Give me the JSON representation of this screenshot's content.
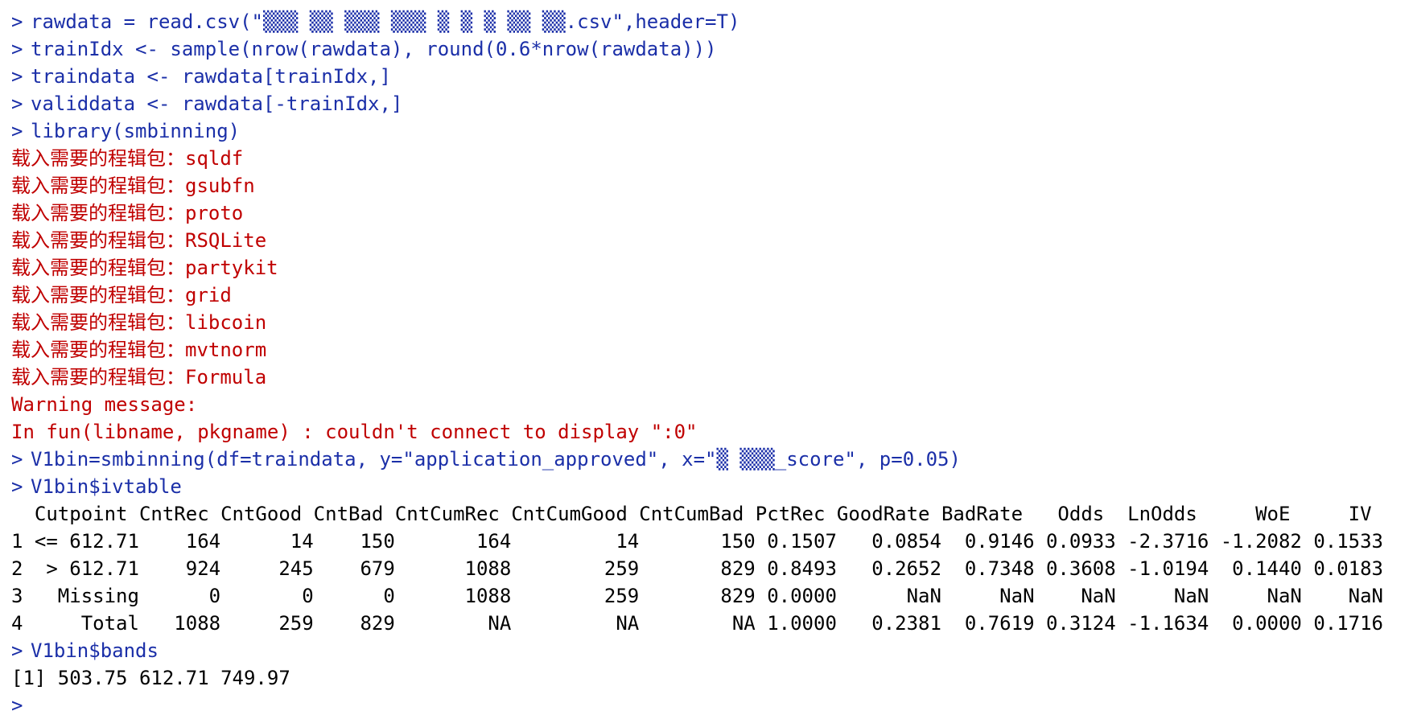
{
  "console": {
    "prompt": ">",
    "colors": {
      "command": "#1b2fa8",
      "message": "#c00000",
      "output": "#000000",
      "background": "#ffffff"
    },
    "lines": [
      {
        "type": "cmd",
        "text": "rawdata = read.csv(\"▒▒▒ ▒▒ ▒▒▒ ▒▒▒ ▒ ▒ ▒ ▒▒ ▒▒.csv\",header=T)"
      },
      {
        "type": "cmd",
        "text": "trainIdx <- sample(nrow(rawdata), round(0.6*nrow(rawdata)))"
      },
      {
        "type": "cmd",
        "text": "traindata <- rawdata[trainIdx,]"
      },
      {
        "type": "cmd",
        "text": "validdata <- rawdata[-trainIdx,]"
      },
      {
        "type": "cmd",
        "text": "library(smbinning)"
      },
      {
        "type": "msg",
        "text": "载入需要的程辑包：sqldf"
      },
      {
        "type": "msg",
        "text": "载入需要的程辑包：gsubfn"
      },
      {
        "type": "msg",
        "text": "载入需要的程辑包：proto"
      },
      {
        "type": "msg",
        "text": "载入需要的程辑包：RSQLite"
      },
      {
        "type": "msg",
        "text": "载入需要的程辑包：partykit"
      },
      {
        "type": "msg",
        "text": "载入需要的程辑包：grid"
      },
      {
        "type": "msg",
        "text": "载入需要的程辑包：libcoin"
      },
      {
        "type": "msg",
        "text": "载入需要的程辑包：mvtnorm"
      },
      {
        "type": "msg",
        "text": "载入需要的程辑包：Formula"
      },
      {
        "type": "msg",
        "text": "Warning message:"
      },
      {
        "type": "msg",
        "text": "In fun(libname, pkgname) : couldn't connect to display \":0\""
      },
      {
        "type": "cmd",
        "text": "V1bin=smbinning(df=traindata, y=\"application_approved\", x=\"▒ ▒▒▒_score\", p=0.05)"
      },
      {
        "type": "cmd",
        "text": "V1bin$ivtable"
      },
      {
        "type": "out",
        "text": "  Cutpoint CntRec CntGood CntBad CntCumRec CntCumGood CntCumBad PctRec GoodRate BadRate   Odds  LnOdds     WoE     IV"
      },
      {
        "type": "out",
        "text": "1 <= 612.71    164      14    150       164         14       150 0.1507   0.0854  0.9146 0.0933 -2.3716 -1.2082 0.1533"
      },
      {
        "type": "out",
        "text": "2  > 612.71    924     245    679      1088        259       829 0.8493   0.2652  0.7348 0.3608 -1.0194  0.1440 0.0183"
      },
      {
        "type": "out",
        "text": "3   Missing      0       0      0      1088        259       829 0.0000      NaN     NaN    NaN     NaN     NaN    NaN"
      },
      {
        "type": "out",
        "text": "4     Total   1088     259    829        NA         NA        NA 1.0000   0.2381  0.7619 0.3124 -1.1634  0.0000 0.1716"
      },
      {
        "type": "cmd",
        "text": "V1bin$bands"
      },
      {
        "type": "out",
        "text": "[1] 503.75 612.71 749.97"
      },
      {
        "type": "cursor",
        "text": ""
      }
    ]
  }
}
